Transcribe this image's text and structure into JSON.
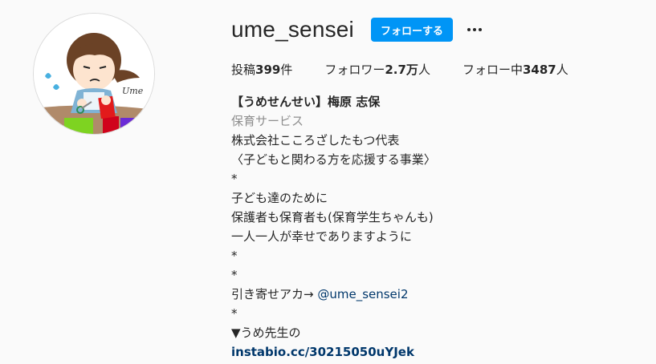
{
  "profile": {
    "username": "ume_sensei",
    "follow_label": "フォローする",
    "more_icon": "more-horizontal-icon",
    "avatar_caption": "Ume"
  },
  "stats": {
    "posts_label": "投稿",
    "posts_value": "399",
    "posts_unit": "件",
    "followers_label": "フォロワー",
    "followers_value": "2.7万",
    "followers_unit": "人",
    "following_label": "フォロー中",
    "following_value": "3487",
    "following_unit": "人"
  },
  "bio": {
    "full_name": "【うめせんせい】梅原 志保",
    "category": "保育サービス",
    "lines": [
      "株式会社こころざしたもつ代表",
      "〈子どもと関わる方を応援する事業〉",
      "*",
      "子ども達のために",
      "保護者も保育者も(保育学生ちゃんも)",
      "一人一人が幸せでありますように",
      "*",
      "*"
    ],
    "mention_prefix": "引き寄せアカ→ ",
    "mention": "@ume_sensei2",
    "line_after_mention": "*",
    "last_text": "▼うめ先生の",
    "link": "instabio.cc/30215050uYJek"
  },
  "colors": {
    "accent": "#0095f6",
    "link": "#00376b",
    "muted": "#8e8e8e",
    "text": "#262626",
    "background": "#fafafa"
  }
}
